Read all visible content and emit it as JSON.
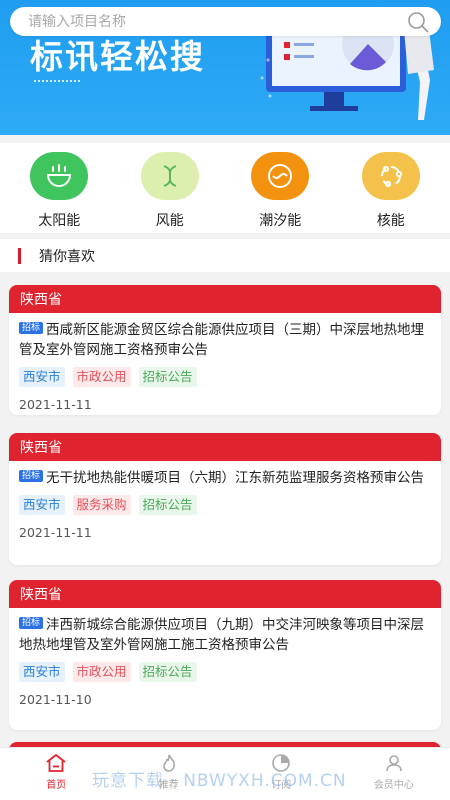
{
  "banner": {
    "title": "标讯轻松搜"
  },
  "search": {
    "placeholder": "请输入项目名称"
  },
  "categories": [
    {
      "label": "太阳能",
      "color": "#3fc45e",
      "icon": "solar-pot-icon"
    },
    {
      "label": "风能",
      "color": "#dcefae",
      "icon": "wind-icon"
    },
    {
      "label": "潮汐能",
      "color": "#f3920e",
      "icon": "tide-wave-icon"
    },
    {
      "label": "核能",
      "color": "#f4c24a",
      "icon": "nuclear-icon"
    }
  ],
  "section": {
    "title": "猜你喜欢"
  },
  "cards": [
    {
      "province": "陕西省",
      "badge": "招标",
      "title": "西咸新区能源金贸区综合能源供应项目（三期）中深层地热地埋管及室外管网施工资格预审公告",
      "city": "西安市",
      "category": "市政公用",
      "type": "招标公告",
      "date": "2021-11-11"
    },
    {
      "province": "陕西省",
      "badge": "招标",
      "title": "无干扰地热能供暖项目（六期）江东新苑监理服务资格预审公告",
      "city": "西安市",
      "category": "服务采购",
      "type": "招标公告",
      "date": "2021-11-11"
    },
    {
      "province": "陕西省",
      "badge": "招标",
      "title": "沣西新城综合能源供应项目（九期）中交沣河映象等项目中深层地热地埋管及室外管网施工施工资格预审公告",
      "city": "西安市",
      "category": "市政公用",
      "type": "招标公告",
      "date": "2021-11-10"
    }
  ],
  "nav": [
    {
      "label": "首页",
      "icon": "home-icon",
      "active": true
    },
    {
      "label": "推荐",
      "icon": "flame-icon",
      "active": false
    },
    {
      "label": "订阅",
      "icon": "pie-chart-icon",
      "active": false
    },
    {
      "label": "会员中心",
      "icon": "user-icon",
      "active": false
    }
  ],
  "watermark": "玩意下载 · NBWYXH.COM.CN",
  "colors": {
    "brand_red": "#e0242f",
    "banner_blue": "#1f9df0",
    "active_nav": "#e0242f"
  }
}
